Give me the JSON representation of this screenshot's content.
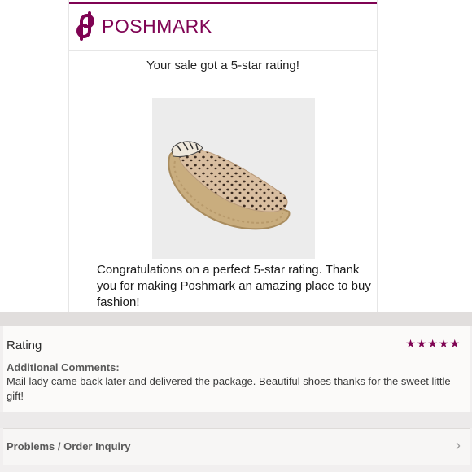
{
  "email": {
    "brand_name": "POSHMARK",
    "subject": "Your sale got a 5-star rating!",
    "congrats": "Congratulations on a perfect 5-star rating. Thank you for making Poshmark an amazing place to buy fashion!",
    "accent_color": "#7f0353"
  },
  "rating": {
    "title": "Rating",
    "stars": "★★★★★",
    "stars_value": 5,
    "stars_max": 5,
    "comments_label": "Additional Comments:",
    "comments_text": "Mail lady came back later and delivered the package. Beautiful shoes thanks for the sweet little gift!"
  },
  "problems": {
    "label": "Problems / Order Inquiry",
    "icon": "chevron-right-icon"
  }
}
